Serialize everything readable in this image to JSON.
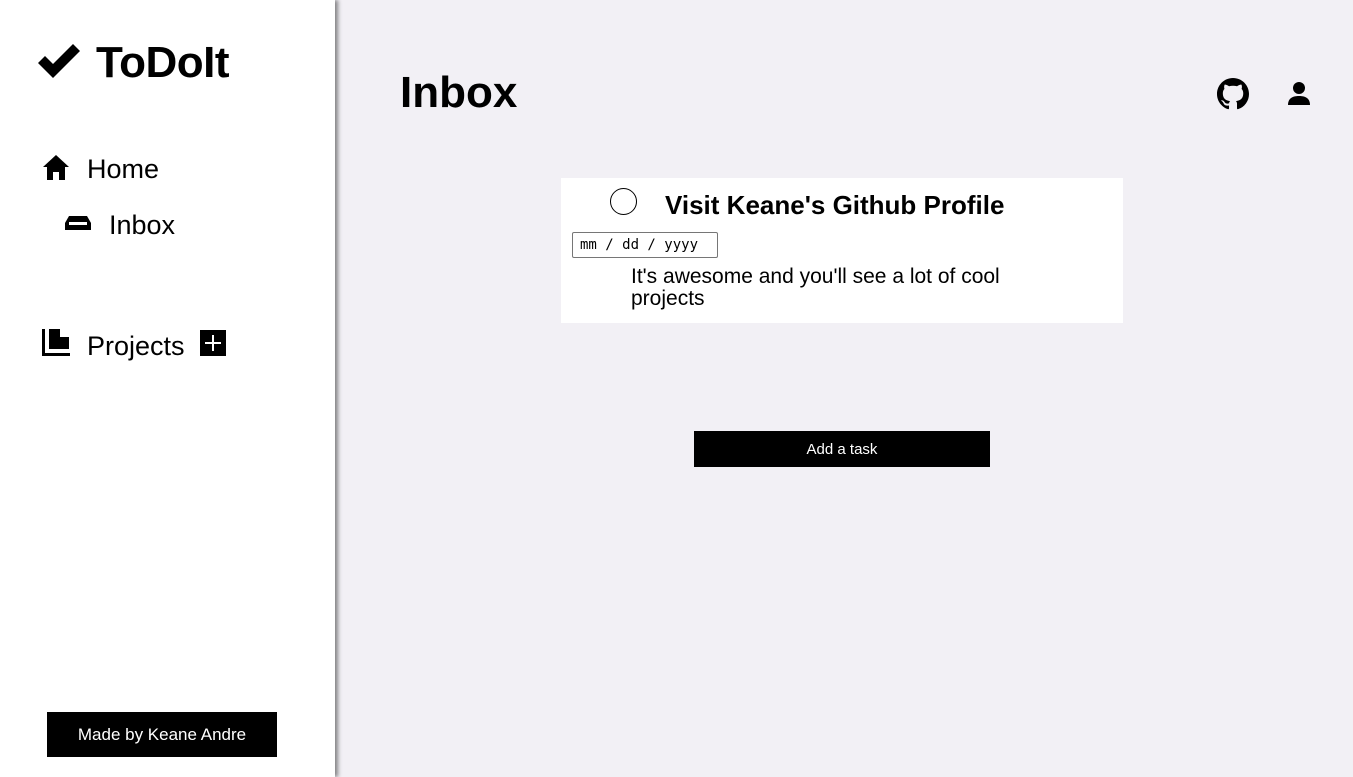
{
  "app": {
    "name": "ToDoIt",
    "logo_icon": "checkmark-icon"
  },
  "sidebar": {
    "items": [
      {
        "label": "Home",
        "icon": "home-icon"
      },
      {
        "label": "Inbox",
        "icon": "inbox-icon"
      },
      {
        "label": "Projects",
        "icon": "projects-icon"
      }
    ],
    "add_project_icon": "plus-icon",
    "footer_label": "Made by Keane Andre"
  },
  "header": {
    "title": "Inbox",
    "icons": [
      "github-icon",
      "user-icon"
    ]
  },
  "tasks": [
    {
      "title": "Visit Keane's Github Profile",
      "date_placeholder": "mm / dd / yyyy",
      "description": "It's awesome and you'll see a lot of cool projects",
      "completed": false
    }
  ],
  "add_task_label": "Add a task",
  "colors": {
    "background": "#f2f0f5",
    "sidebar": "#ffffff",
    "button": "#000000",
    "button_text": "#ffffff"
  }
}
